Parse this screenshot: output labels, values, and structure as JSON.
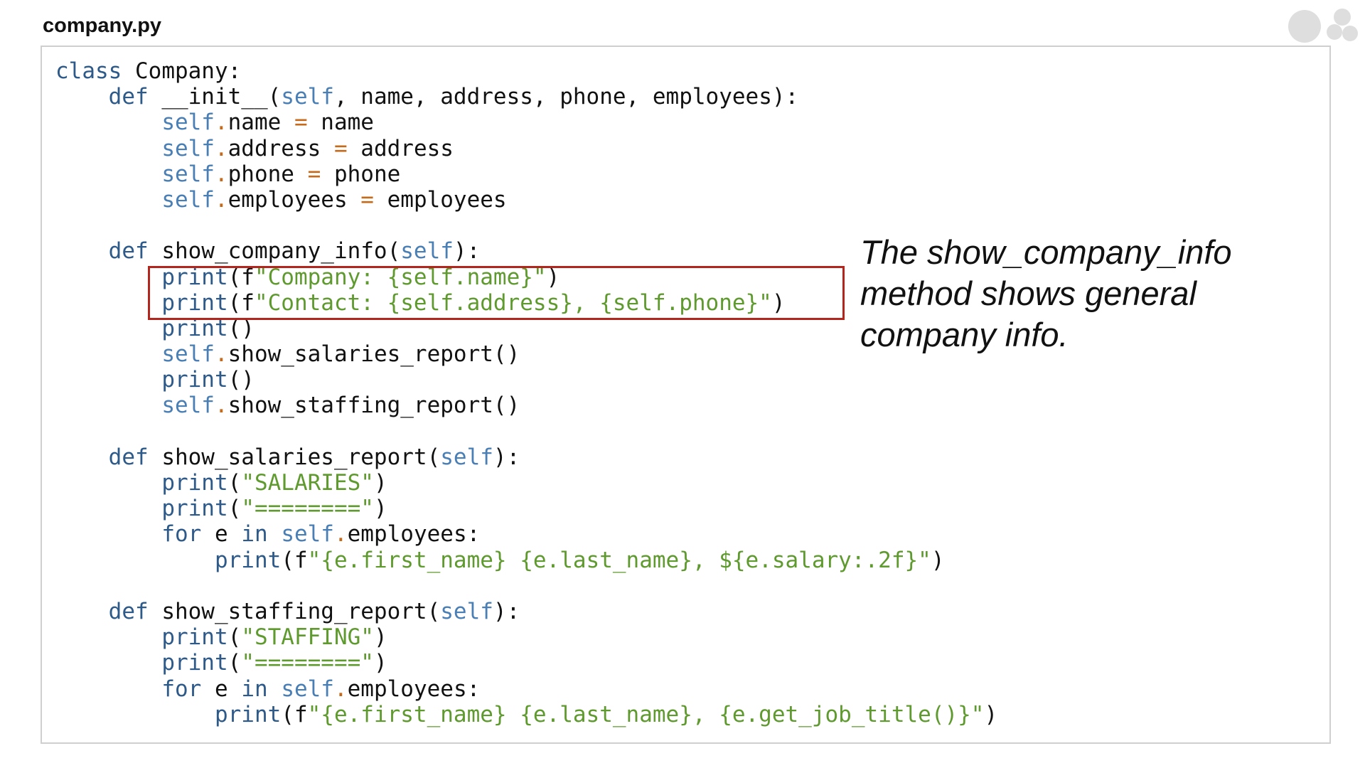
{
  "file_title": "company.py",
  "annotation": "The show_company_info method shows general company info.",
  "colors": {
    "keyword": "#2e5a8a",
    "self": "#4a7fb5",
    "string": "#5f9a2f",
    "operator": "#c66a1a",
    "highlight_border": "#b3261e"
  },
  "code_lines": [
    [
      [
        "kw",
        "class"
      ],
      [
        "tx",
        " Company:"
      ]
    ],
    [
      [
        "tx",
        "    "
      ],
      [
        "kw",
        "def"
      ],
      [
        "tx",
        " __init__("
      ],
      [
        "self",
        "self"
      ],
      [
        "tx",
        ", name, address, phone, employees):"
      ]
    ],
    [
      [
        "tx",
        "        "
      ],
      [
        "self",
        "self"
      ],
      [
        "op",
        "."
      ],
      [
        "tx",
        "name "
      ],
      [
        "op",
        "="
      ],
      [
        "tx",
        " name"
      ]
    ],
    [
      [
        "tx",
        "        "
      ],
      [
        "self",
        "self"
      ],
      [
        "op",
        "."
      ],
      [
        "tx",
        "address "
      ],
      [
        "op",
        "="
      ],
      [
        "tx",
        " address"
      ]
    ],
    [
      [
        "tx",
        "        "
      ],
      [
        "self",
        "self"
      ],
      [
        "op",
        "."
      ],
      [
        "tx",
        "phone "
      ],
      [
        "op",
        "="
      ],
      [
        "tx",
        " phone"
      ]
    ],
    [
      [
        "tx",
        "        "
      ],
      [
        "self",
        "self"
      ],
      [
        "op",
        "."
      ],
      [
        "tx",
        "employees "
      ],
      [
        "op",
        "="
      ],
      [
        "tx",
        " employees"
      ]
    ],
    [],
    [
      [
        "tx",
        "    "
      ],
      [
        "kw",
        "def"
      ],
      [
        "tx",
        " show_company_info("
      ],
      [
        "self",
        "self"
      ],
      [
        "tx",
        "):"
      ]
    ],
    [
      [
        "tx",
        "        "
      ],
      [
        "kw",
        "print"
      ],
      [
        "tx",
        "(f"
      ],
      [
        "str",
        "\"Company: {self.name}\""
      ],
      [
        "tx",
        ")"
      ]
    ],
    [
      [
        "tx",
        "        "
      ],
      [
        "kw",
        "print"
      ],
      [
        "tx",
        "(f"
      ],
      [
        "str",
        "\"Contact: {self.address}, {self.phone}\""
      ],
      [
        "tx",
        ")"
      ]
    ],
    [
      [
        "tx",
        "        "
      ],
      [
        "kw",
        "print"
      ],
      [
        "tx",
        "()"
      ]
    ],
    [
      [
        "tx",
        "        "
      ],
      [
        "self",
        "self"
      ],
      [
        "op",
        "."
      ],
      [
        "tx",
        "show_salaries_report()"
      ]
    ],
    [
      [
        "tx",
        "        "
      ],
      [
        "kw",
        "print"
      ],
      [
        "tx",
        "()"
      ]
    ],
    [
      [
        "tx",
        "        "
      ],
      [
        "self",
        "self"
      ],
      [
        "op",
        "."
      ],
      [
        "tx",
        "show_staffing_report()"
      ]
    ],
    [],
    [
      [
        "tx",
        "    "
      ],
      [
        "kw",
        "def"
      ],
      [
        "tx",
        " show_salaries_report("
      ],
      [
        "self",
        "self"
      ],
      [
        "tx",
        "):"
      ]
    ],
    [
      [
        "tx",
        "        "
      ],
      [
        "kw",
        "print"
      ],
      [
        "tx",
        "("
      ],
      [
        "str",
        "\"SALARIES\""
      ],
      [
        "tx",
        ")"
      ]
    ],
    [
      [
        "tx",
        "        "
      ],
      [
        "kw",
        "print"
      ],
      [
        "tx",
        "("
      ],
      [
        "str",
        "\"========\""
      ],
      [
        "tx",
        ")"
      ]
    ],
    [
      [
        "tx",
        "        "
      ],
      [
        "kw",
        "for"
      ],
      [
        "tx",
        " e "
      ],
      [
        "kw",
        "in"
      ],
      [
        "tx",
        " "
      ],
      [
        "self",
        "self"
      ],
      [
        "op",
        "."
      ],
      [
        "tx",
        "employees:"
      ]
    ],
    [
      [
        "tx",
        "            "
      ],
      [
        "kw",
        "print"
      ],
      [
        "tx",
        "(f"
      ],
      [
        "str",
        "\"{e.first_name} {e.last_name}, ${e.salary:.2f}\""
      ],
      [
        "tx",
        ")"
      ]
    ],
    [],
    [
      [
        "tx",
        "    "
      ],
      [
        "kw",
        "def"
      ],
      [
        "tx",
        " show_staffing_report("
      ],
      [
        "self",
        "self"
      ],
      [
        "tx",
        "):"
      ]
    ],
    [
      [
        "tx",
        "        "
      ],
      [
        "kw",
        "print"
      ],
      [
        "tx",
        "("
      ],
      [
        "str",
        "\"STAFFING\""
      ],
      [
        "tx",
        ")"
      ]
    ],
    [
      [
        "tx",
        "        "
      ],
      [
        "kw",
        "print"
      ],
      [
        "tx",
        "("
      ],
      [
        "str",
        "\"========\""
      ],
      [
        "tx",
        ")"
      ]
    ],
    [
      [
        "tx",
        "        "
      ],
      [
        "kw",
        "for"
      ],
      [
        "tx",
        " e "
      ],
      [
        "kw",
        "in"
      ],
      [
        "tx",
        " "
      ],
      [
        "self",
        "self"
      ],
      [
        "op",
        "."
      ],
      [
        "tx",
        "employees:"
      ]
    ],
    [
      [
        "tx",
        "            "
      ],
      [
        "kw",
        "print"
      ],
      [
        "tx",
        "(f"
      ],
      [
        "str",
        "\"{e.first_name} {e.last_name}, {e.get_job_title()}\""
      ],
      [
        "tx",
        ")"
      ]
    ]
  ]
}
